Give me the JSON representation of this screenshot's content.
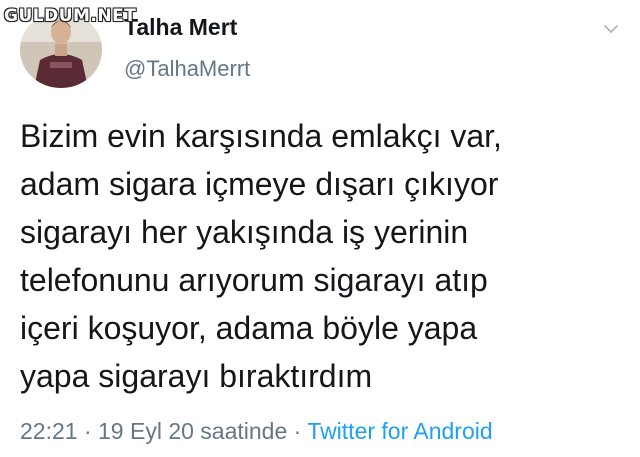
{
  "watermark": "GULDUM.NET",
  "user": {
    "display_name": "Talha Mert",
    "handle": "@TalhaMerrt",
    "avatar_icon": "profile-photo"
  },
  "menu": {
    "icon": "chevron-down-icon"
  },
  "tweet": {
    "lines": [
      "Bizim evin karşısında emlakçı var,",
      "adam sigara içmeye dışarı çıkıyor",
      "sigarayı her yakışında iş yerinin",
      "telefonunu arıyorum sigarayı atıp",
      "içeri koşuyor, adama böyle yapa",
      "yapa sigarayı bıraktırdım"
    ]
  },
  "meta": {
    "time": "22:21",
    "separator": " · ",
    "date": "19 Eyl 20 saatinde",
    "source": "Twitter for Android"
  },
  "colors": {
    "text": "#14171a",
    "secondary": "#657786",
    "link": "#1da1f2"
  }
}
